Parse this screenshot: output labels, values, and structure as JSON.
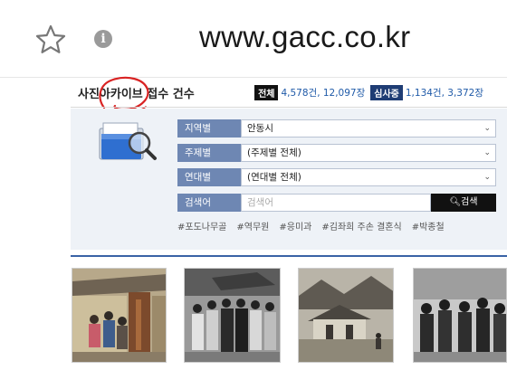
{
  "browser": {
    "url": "www.gacc.co.kr",
    "icons": [
      "star-icon",
      "info-icon"
    ],
    "info_glyph": "i"
  },
  "header": {
    "title": "사진아카이브 접수 건수",
    "total_badge": "전체",
    "total_value": "4,578건, 12,097장",
    "review_badge": "심사중",
    "review_value": "1,134건, 3,372장"
  },
  "search": {
    "rows": [
      {
        "label": "지역별",
        "value": "안동시"
      },
      {
        "label": "주제별",
        "value": "(주제별 전체)"
      },
      {
        "label": "연대별",
        "value": "(연대별 전체)"
      }
    ],
    "keyword_label": "검색어",
    "keyword_placeholder": "검색어",
    "button_label": "검색"
  },
  "tags": [
    "#포도나무골",
    "#역무원",
    "#응미과",
    "#김좌희 주손 결혼식",
    "#박종철"
  ],
  "colors": {
    "accent_blue": "#1f5aa8",
    "label_bg": "#6e87b3",
    "panel_bg": "#eef2f7",
    "badge_review": "#1f3d74",
    "scribble_red": "#d92323"
  }
}
